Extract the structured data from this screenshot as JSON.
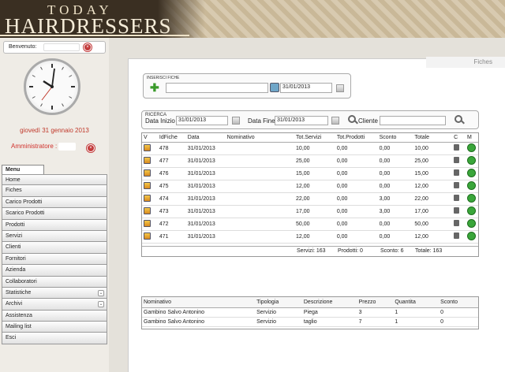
{
  "header": {
    "logo_top": "TODAY",
    "logo_main": "HAIRDRESSERS"
  },
  "sidebar": {
    "welcome_label": "Benvenuto:",
    "date": "giovedì 31 gennaio 2013",
    "admin_label": "Amministratore :",
    "menu_tab": "Menu",
    "menu": [
      {
        "label": "Home",
        "expand": false
      },
      {
        "label": "Fiches",
        "expand": false
      },
      {
        "label": "Carico Prodotti",
        "expand": false
      },
      {
        "label": "Scarico Prodotti",
        "expand": false
      },
      {
        "label": "Prodotti",
        "expand": false
      },
      {
        "label": "Servizi",
        "expand": false
      },
      {
        "label": "Clienti",
        "expand": false
      },
      {
        "label": "Fornitori",
        "expand": false
      },
      {
        "label": "Azienda",
        "expand": false
      },
      {
        "label": "Collaboratori",
        "expand": false
      },
      {
        "label": "Statistiche",
        "expand": true
      },
      {
        "label": "Archivi",
        "expand": true
      },
      {
        "label": "Assistenza",
        "expand": false
      },
      {
        "label": "Mailing list",
        "expand": false
      },
      {
        "label": "Esci",
        "expand": false
      }
    ]
  },
  "page": {
    "title": "Fiches"
  },
  "inserisci": {
    "title": "INSERISCI FICHE",
    "name_value": "",
    "date_value": "31/01/2013"
  },
  "ricerca": {
    "title": "RICERCA",
    "data_inizio_label": "Data Inizio",
    "data_inizio_value": "31/01/2013",
    "data_fine_label": "Data Fine",
    "data_fine_value": "31/01/2013",
    "cliente_label": "Cliente",
    "cliente_value": ""
  },
  "fiches_table": {
    "columns": [
      "V",
      "IdFiche",
      "Data",
      "Nominativo",
      "Tot.Servizi",
      "Tot.Prodotti",
      "Sconto",
      "Totale",
      "C",
      "M"
    ],
    "rows": [
      {
        "id": "478",
        "data": "31/01/2013",
        "nominativo": "",
        "servizi": "10,00",
        "prodotti": "0,00",
        "sconto": "0,00",
        "totale": "10,00"
      },
      {
        "id": "477",
        "data": "31/01/2013",
        "nominativo": "",
        "servizi": "25,00",
        "prodotti": "0,00",
        "sconto": "0,00",
        "totale": "25,00"
      },
      {
        "id": "476",
        "data": "31/01/2013",
        "nominativo": "",
        "servizi": "15,00",
        "prodotti": "0,00",
        "sconto": "0,00",
        "totale": "15,00"
      },
      {
        "id": "475",
        "data": "31/01/2013",
        "nominativo": "",
        "servizi": "12,00",
        "prodotti": "0,00",
        "sconto": "0,00",
        "totale": "12,00"
      },
      {
        "id": "474",
        "data": "31/01/2013",
        "nominativo": "",
        "servizi": "22,00",
        "prodotti": "0,00",
        "sconto": "3,00",
        "totale": "22,00"
      },
      {
        "id": "473",
        "data": "31/01/2013",
        "nominativo": "",
        "servizi": "17,00",
        "prodotti": "0,00",
        "sconto": "3,00",
        "totale": "17,00"
      },
      {
        "id": "472",
        "data": "31/01/2013",
        "nominativo": "",
        "servizi": "50,00",
        "prodotti": "0,00",
        "sconto": "0,00",
        "totale": "50,00"
      },
      {
        "id": "471",
        "data": "31/01/2013",
        "nominativo": "",
        "servizi": "12,00",
        "prodotti": "0,00",
        "sconto": "0,00",
        "totale": "12,00"
      }
    ],
    "totals": {
      "servizi": "Servizi: 163",
      "prodotti": "Prodotti: 0",
      "sconto": "Sconto: 6",
      "totale": "Totale: 163"
    }
  },
  "detail_table": {
    "columns": [
      "Nominativo",
      "Tipologia",
      "Descrizione",
      "Prezzo",
      "Quantita",
      "Sconto"
    ],
    "rows": [
      [
        "Gambino Salvo Antonino",
        "Servizio",
        "Piega",
        "3",
        "1",
        "0"
      ],
      [
        "Gambino Salvo Antonino",
        "Servizio",
        "taglio",
        "7",
        "1",
        "0"
      ]
    ]
  },
  "icons": {
    "edit": "edit-fiche-icon",
    "delete": "trash-icon",
    "modify": "modify-icon",
    "add": "plus-icon",
    "calendar": "calendar-icon",
    "search": "search-icon"
  },
  "colors": {
    "accent_red": "#c0392b",
    "add_green": "#3a9a2a",
    "header_dark": "#3a2f22"
  }
}
